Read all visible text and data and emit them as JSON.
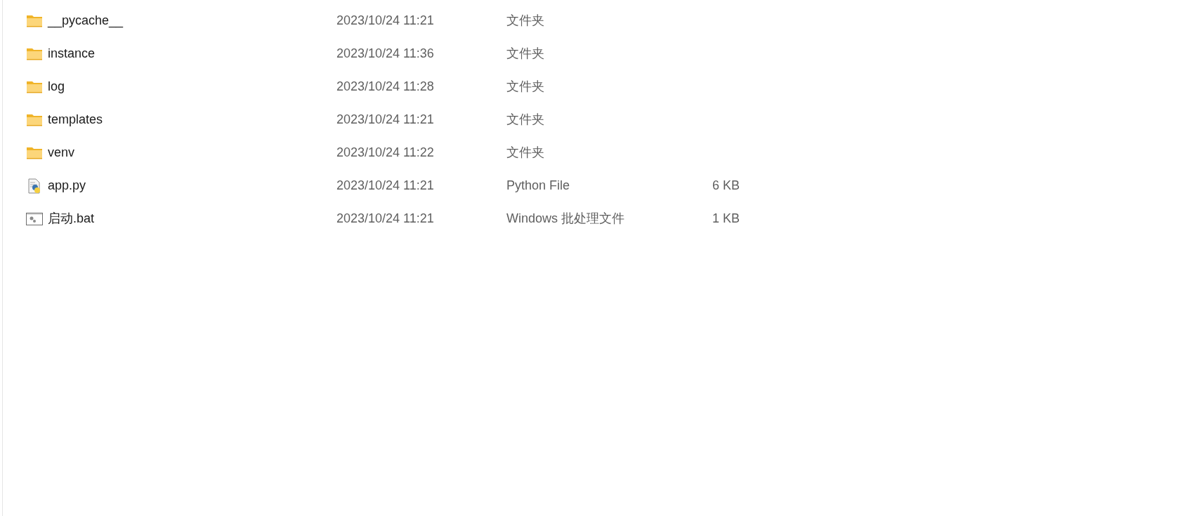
{
  "files": [
    {
      "kind": "folder",
      "name": "__pycache__",
      "modified": "2023/10/24 11:21",
      "type": "文件夹"
    },
    {
      "kind": "folder",
      "name": "instance",
      "modified": "2023/10/24 11:36",
      "type": "文件夹"
    },
    {
      "kind": "folder",
      "name": "log",
      "modified": "2023/10/24 11:28",
      "type": "文件夹"
    },
    {
      "kind": "folder",
      "name": "templates",
      "modified": "2023/10/24 11:21",
      "type": "文件夹"
    },
    {
      "kind": "folder",
      "name": "venv",
      "modified": "2023/10/24 11:22",
      "type": "文件夹"
    },
    {
      "kind": "python",
      "name": "app.py",
      "modified": "2023/10/24 11:21",
      "type": "Python File",
      "size": "6 KB"
    },
    {
      "kind": "batch",
      "name": "启动.bat",
      "modified": "2023/10/24 11:21",
      "type": "Windows 批处理文件",
      "size": "1 KB"
    }
  ]
}
